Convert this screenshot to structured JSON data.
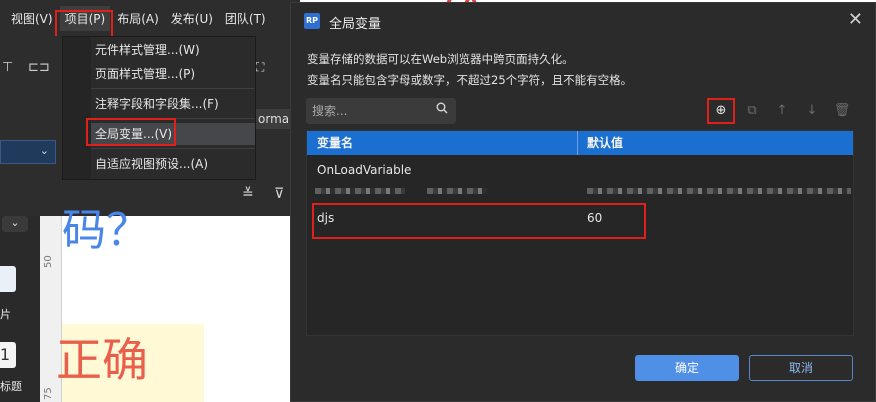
{
  "menubar": {
    "items": [
      "视图(V)",
      "项目(P)",
      "布局(A)",
      "发布(U)",
      "团队(T)"
    ]
  },
  "project_menu": {
    "items": [
      "元件样式管理...(W)",
      "页面样式管理...(P)",
      "注释字段和字段集...(F)",
      "全局变量...(V)",
      "自适应视图预设...(A)"
    ]
  },
  "toolbar": {
    "format_label": "ormal"
  },
  "ruler": {
    "ticks": [
      "50",
      "75"
    ]
  },
  "canvas": {
    "question_text": "码？",
    "correct_text": "正确"
  },
  "left_panel": {
    "label_1": "片",
    "label_2": "标题",
    "widget_2_text": "1"
  },
  "dialog": {
    "logo_text": "RP",
    "title": "全局变量",
    "desc_line_1": "变量存储的数据可以在Web浏览器中跨页面持久化。",
    "desc_line_2": "变量名只能包含字母或数字，不超过25个字符，且不能有空格。",
    "search_placeholder": "搜索...",
    "columns": [
      "变量名",
      "默认值"
    ],
    "rows": [
      {
        "name": "OnLoadVariable",
        "value": ""
      },
      {
        "name": "djs",
        "value": "60"
      }
    ],
    "ok_label": "确定",
    "cancel_label": "取消"
  },
  "colors": {
    "accent": "#1b6fd1",
    "highlight_border": "#e0201a",
    "primary_button": "#4f8fe6"
  }
}
